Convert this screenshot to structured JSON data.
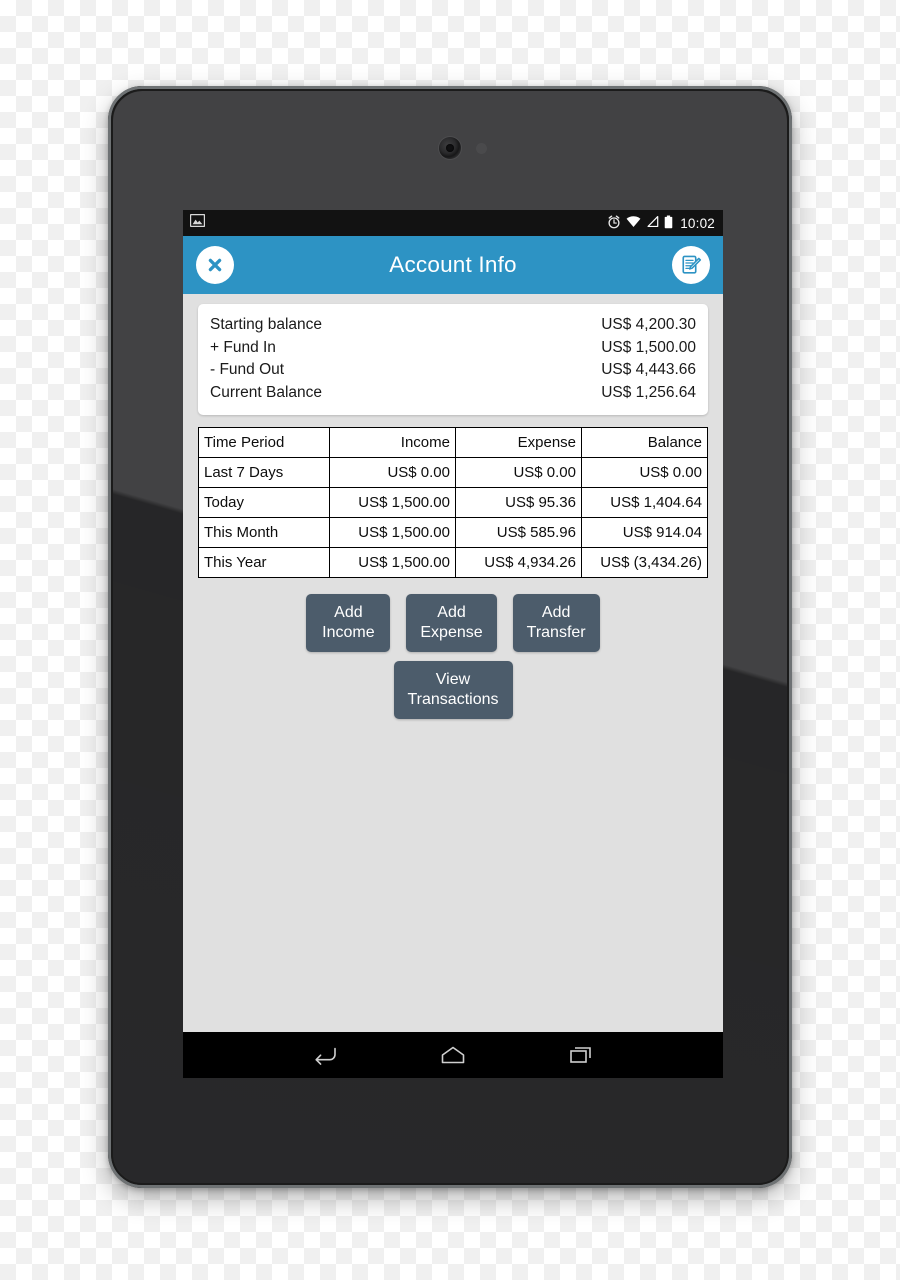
{
  "device": {
    "camera_icon": "front-camera",
    "sensor_icon": "proximity-sensor"
  },
  "status_bar": {
    "notification_icon": "screenshot-image-icon",
    "icons": [
      "alarm-clock-icon",
      "wifi-icon",
      "signal-icon",
      "battery-icon"
    ],
    "time": "10:02"
  },
  "action_bar": {
    "title": "Account Info",
    "close_icon": "close-x-icon",
    "edit_icon": "edit-document-icon",
    "background_color": "#2d93c4"
  },
  "summary": {
    "rows": [
      {
        "label": "Starting balance",
        "value": "US$ 4,200.30"
      },
      {
        "label": "+ Fund In",
        "value": "US$ 1,500.00"
      },
      {
        "label": "- Fund Out",
        "value": "US$ 4,443.66"
      },
      {
        "label": "Current Balance",
        "value": "US$ 1,256.64"
      }
    ]
  },
  "table": {
    "headers": [
      "Time Period",
      "Income",
      "Expense",
      "Balance"
    ],
    "rows": [
      {
        "period": "Last 7 Days",
        "income": "US$ 0.00",
        "expense": "US$ 0.00",
        "balance": "US$ 0.00"
      },
      {
        "period": "Today",
        "income": "US$ 1,500.00",
        "expense": "US$ 95.36",
        "balance": "US$ 1,404.64"
      },
      {
        "period": "This Month",
        "income": "US$ 1,500.00",
        "expense": "US$ 585.96",
        "balance": "US$ 914.04"
      },
      {
        "period": "This Year",
        "income": "US$ 1,500.00",
        "expense": "US$ 4,934.26",
        "balance": "US$ (3,434.26)"
      }
    ]
  },
  "buttons": {
    "add_income": {
      "line1": "Add",
      "line2": "Income"
    },
    "add_expense": {
      "line1": "Add",
      "line2": "Expense"
    },
    "add_transfer": {
      "line1": "Add",
      "line2": "Transfer"
    },
    "view_transactions": {
      "line1": "View",
      "line2": "Transactions"
    },
    "color": "#4c5c6b"
  },
  "nav_bar": {
    "back_icon": "back-arrow-icon",
    "home_icon": "home-icon",
    "recents_icon": "recent-apps-icon"
  },
  "theme": {
    "screen_background": "#e0e0e0",
    "card_background": "#ffffff",
    "accent": "#2d93c4"
  }
}
